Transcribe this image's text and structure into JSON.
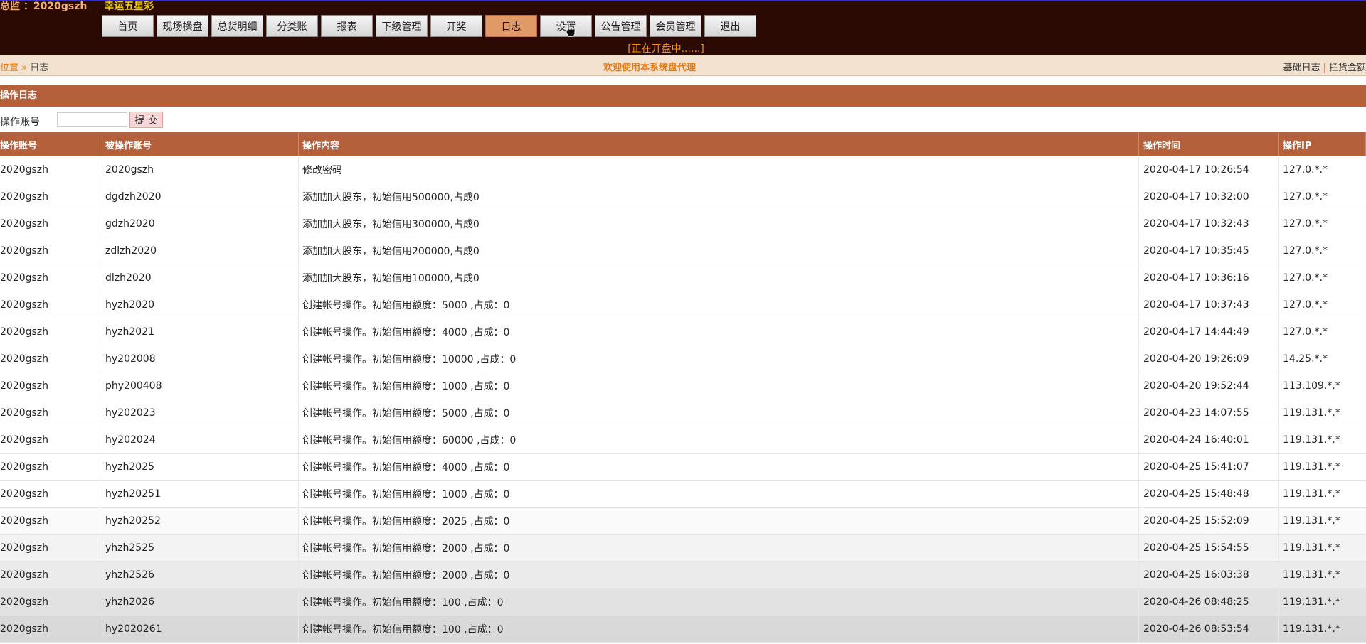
{
  "brand": {
    "account": "总监 ：2020gszh",
    "game": "幸运五星彩"
  },
  "nav": [
    "首页",
    "现场操盘",
    "总货明细",
    "分类账",
    "报表",
    "下级管理",
    "开奖",
    "日志",
    "设置",
    "公告管理",
    "会员管理",
    "退出"
  ],
  "nav_active_index": 7,
  "status_text": "[正在开盘中......]",
  "breadcrumb": {
    "position": "位置",
    "separator": "»",
    "current": "日志"
  },
  "welcome": "欢迎使用本系统盘代理",
  "right_links": [
    "基础日志",
    "拦货金额"
  ],
  "section_title": "操作日志",
  "search": {
    "label": "操作账号",
    "value": "",
    "button": "提 交"
  },
  "table": {
    "headers": [
      "操作账号",
      "被操作账号",
      "操作内容",
      "操作时间",
      "操作IP"
    ],
    "rows": [
      [
        "2020gszh",
        "2020gszh",
        "修改密码",
        "2020-04-17 10:26:54",
        "127.0.*.*"
      ],
      [
        "2020gszh",
        "dgdzh2020",
        "添加加大股东，初始信用500000,占成0",
        "2020-04-17 10:32:00",
        "127.0.*.*"
      ],
      [
        "2020gszh",
        "gdzh2020",
        "添加加大股东，初始信用300000,占成0",
        "2020-04-17 10:32:43",
        "127.0.*.*"
      ],
      [
        "2020gszh",
        "zdlzh2020",
        "添加加大股东，初始信用200000,占成0",
        "2020-04-17 10:35:45",
        "127.0.*.*"
      ],
      [
        "2020gszh",
        "dlzh2020",
        "添加加大股东，初始信用100000,占成0",
        "2020-04-17 10:36:16",
        "127.0.*.*"
      ],
      [
        "2020gszh",
        "hyzh2020",
        "创建帐号操作。初始信用额度：5000 ,占成：0",
        "2020-04-17 10:37:43",
        "127.0.*.*"
      ],
      [
        "2020gszh",
        "hyzh2021",
        "创建帐号操作。初始信用额度：4000 ,占成：0",
        "2020-04-17 14:44:49",
        "127.0.*.*"
      ],
      [
        "2020gszh",
        "hy202008",
        "创建帐号操作。初始信用额度：10000 ,占成：0",
        "2020-04-20 19:26:09",
        "14.25.*.*"
      ],
      [
        "2020gszh",
        "phy200408",
        "创建帐号操作。初始信用额度：1000 ,占成：0",
        "2020-04-20 19:52:44",
        "113.109.*.*"
      ],
      [
        "2020gszh",
        "hy202023",
        "创建帐号操作。初始信用额度：5000 ,占成：0",
        "2020-04-23 14:07:55",
        "119.131.*.*"
      ],
      [
        "2020gszh",
        "hy202024",
        "创建帐号操作。初始信用额度：60000 ,占成：0",
        "2020-04-24 16:40:01",
        "119.131.*.*"
      ],
      [
        "2020gszh",
        "hyzh2025",
        "创建帐号操作。初始信用额度：4000 ,占成：0",
        "2020-04-25 15:41:07",
        "119.131.*.*"
      ],
      [
        "2020gszh",
        "hyzh20251",
        "创建帐号操作。初始信用额度：1000 ,占成：0",
        "2020-04-25 15:48:48",
        "119.131.*.*"
      ],
      [
        "2020gszh",
        "hyzh20252",
        "创建帐号操作。初始信用额度：2025 ,占成：0",
        "2020-04-25 15:52:09",
        "119.131.*.*"
      ],
      [
        "2020gszh",
        "yhzh2525",
        "创建帐号操作。初始信用额度：2000 ,占成：0",
        "2020-04-25 15:54:55",
        "119.131.*.*"
      ],
      [
        "2020gszh",
        "yhzh2526",
        "创建帐号操作。初始信用额度：2000 ,占成：0",
        "2020-04-25 16:03:38",
        "119.131.*.*"
      ],
      [
        "2020gszh",
        "yhzh2026",
        "创建帐号操作。初始信用额度：100 ,占成：0",
        "2020-04-26 08:48:25",
        "119.131.*.*"
      ],
      [
        "2020gszh",
        "hy2020261",
        "创建帐号操作。初始信用额度：100 ,占成：0",
        "2020-04-26 08:53:54",
        "119.131.*.*"
      ]
    ]
  },
  "colors": {
    "topbar": "#2a0a03",
    "accent": "#b3603b",
    "orange_text": "#e07b16",
    "game_title": "#f0d000",
    "active_tab": "#e09a68"
  }
}
